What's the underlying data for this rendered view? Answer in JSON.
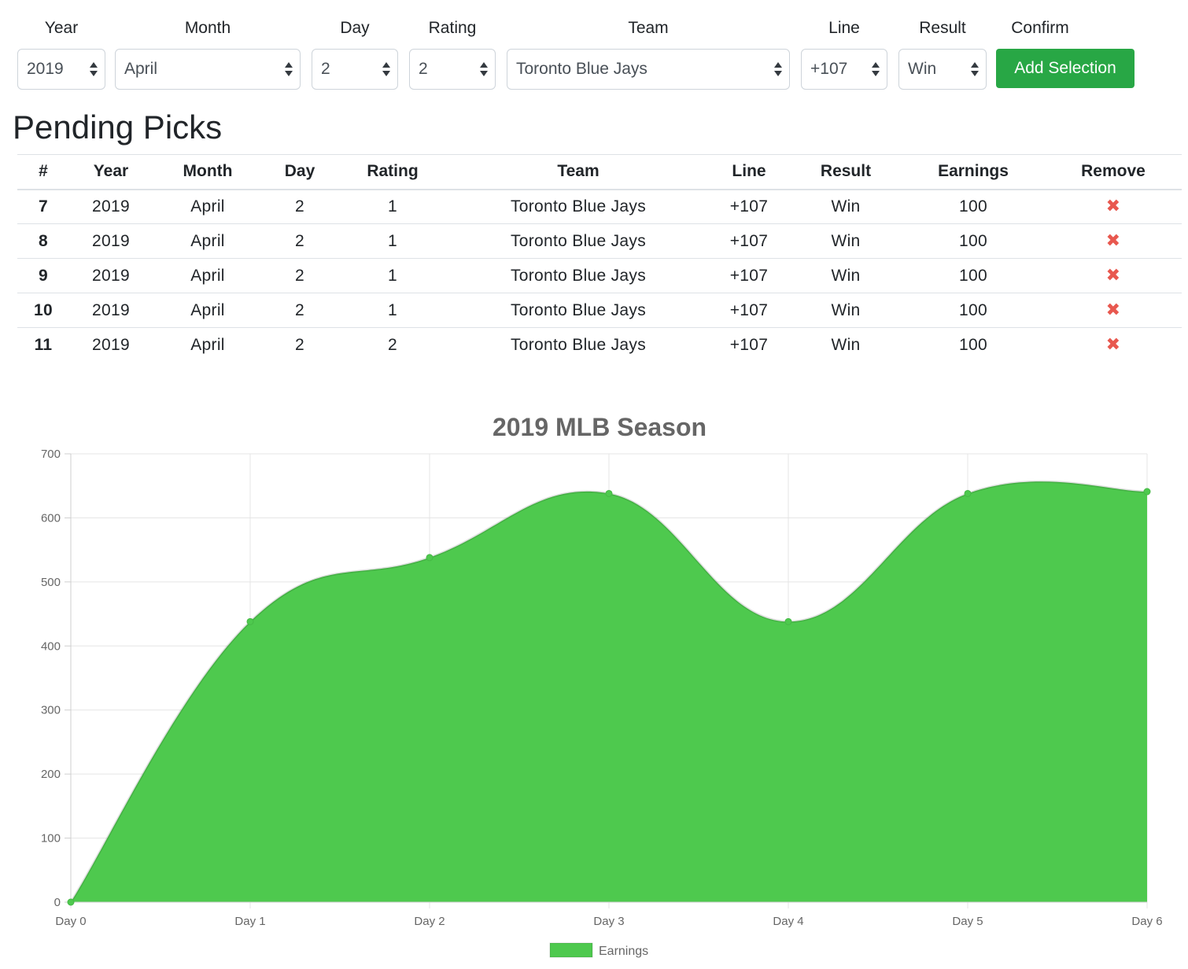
{
  "form": {
    "fields": [
      {
        "label": "Year",
        "value": "2019"
      },
      {
        "label": "Month",
        "value": "April"
      },
      {
        "label": "Day",
        "value": "2"
      },
      {
        "label": "Rating",
        "value": "2"
      },
      {
        "label": "Team",
        "value": "Toronto Blue Jays"
      },
      {
        "label": "Line",
        "value": "+107"
      },
      {
        "label": "Result",
        "value": "Win"
      }
    ],
    "confirm_label": "Confirm",
    "add_button": "Add Selection"
  },
  "page_title": "Pending Picks",
  "table": {
    "headers": [
      "#",
      "Year",
      "Month",
      "Day",
      "Rating",
      "Team",
      "Line",
      "Result",
      "Earnings",
      "Remove"
    ],
    "rows": [
      {
        "num": "7",
        "year": "2019",
        "month": "April",
        "day": "2",
        "rating": "1",
        "team": "Toronto Blue Jays",
        "line": "+107",
        "result": "Win",
        "earnings": "100"
      },
      {
        "num": "8",
        "year": "2019",
        "month": "April",
        "day": "2",
        "rating": "1",
        "team": "Toronto Blue Jays",
        "line": "+107",
        "result": "Win",
        "earnings": "100"
      },
      {
        "num": "9",
        "year": "2019",
        "month": "April",
        "day": "2",
        "rating": "1",
        "team": "Toronto Blue Jays",
        "line": "+107",
        "result": "Win",
        "earnings": "100"
      },
      {
        "num": "10",
        "year": "2019",
        "month": "April",
        "day": "2",
        "rating": "1",
        "team": "Toronto Blue Jays",
        "line": "+107",
        "result": "Win",
        "earnings": "100"
      },
      {
        "num": "11",
        "year": "2019",
        "month": "April",
        "day": "2",
        "rating": "2",
        "team": "Toronto Blue Jays",
        "line": "+107",
        "result": "Win",
        "earnings": "100"
      }
    ],
    "remove_icon": "close-x-icon",
    "remove_color": "#e8584f"
  },
  "chart_data": {
    "type": "area",
    "title": "2019 MLB Season",
    "categories": [
      "Day 0",
      "Day 1",
      "Day 2",
      "Day 3",
      "Day 4",
      "Day 5",
      "Day 6"
    ],
    "series": [
      {
        "name": "Earnings",
        "values": [
          0,
          438,
          538,
          638,
          438,
          638,
          641
        ],
        "color": "#4ec94e"
      }
    ],
    "ylim": [
      0,
      700
    ],
    "yticks": [
      0,
      100,
      200,
      300,
      400,
      500,
      600,
      700
    ],
    "grid": true,
    "legend": "bottom"
  },
  "colors": {
    "primary_button": "#28a745",
    "area_fill": "#4ec94e"
  }
}
